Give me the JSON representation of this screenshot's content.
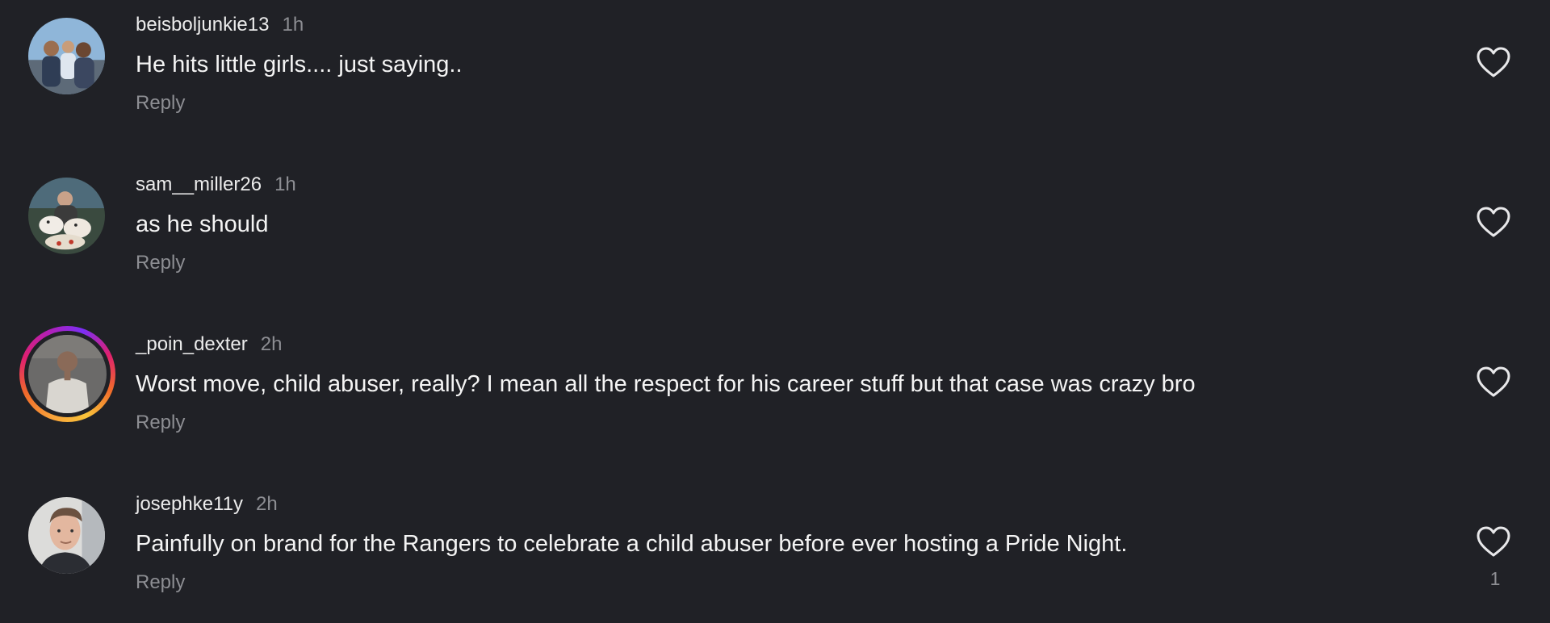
{
  "comments": [
    {
      "username": "beisboljunkie13",
      "time": "1h",
      "text": "He hits little girls.... just saying..",
      "reply_label": "Reply",
      "like_icon": "heart-outline-icon"
    },
    {
      "username": "sam__miller26",
      "time": "1h",
      "text": "as he should",
      "reply_label": "Reply",
      "like_icon": "heart-outline-icon"
    },
    {
      "username": "_poin_dexter",
      "time": "2h",
      "text": "Worst move, child abuser, really? I mean all the respect for his career stuff but that case was crazy bro",
      "reply_label": "Reply",
      "like_icon": "heart-outline-icon",
      "story_ring": true
    },
    {
      "username": "josephke11y",
      "time": "2h",
      "text": "Painfully on brand for the Rangers to celebrate a child abuser before ever hosting a Pride Night.",
      "reply_label": "Reply",
      "like_icon": "heart-outline-icon",
      "like_count": "1"
    }
  ],
  "colors": {
    "background": "#202126",
    "primary_text": "#f4f4f4",
    "secondary_text": "#8d8e93"
  }
}
